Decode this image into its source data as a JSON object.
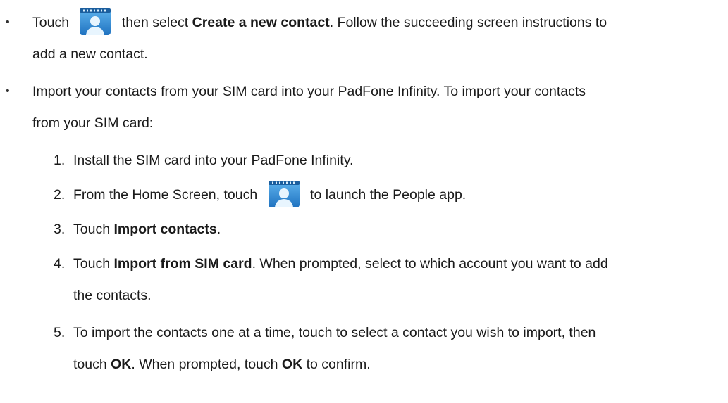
{
  "items": [
    {
      "bullet": "•",
      "line1_a": "Touch",
      "line1_b": "then select",
      "line1_bold": "Create a new contact",
      "line1_c": ". Follow the succeeding screen instructions to",
      "line2": "add a new contact."
    },
    {
      "bullet": "•",
      "line1": "Import your contacts from your SIM card into your PadFone Infinity. To import your contacts",
      "line2": "from your SIM card:"
    }
  ],
  "steps": [
    {
      "num": "1.",
      "text": "Install the SIM card into your PadFone Infinity."
    },
    {
      "num": "2.",
      "text_a": "From the Home Screen, touch",
      "text_b": "to launch the People app."
    },
    {
      "num": "3.",
      "text_a": "Touch",
      "bold": "Import contacts",
      "text_b": "."
    },
    {
      "num": "4.",
      "text_a": "Touch",
      "bold": "Import from SIM card",
      "text_b": ". When prompted, select to which account you want to add",
      "line2": "the contacts."
    },
    {
      "num": "5.",
      "line1": "To import the contacts one at a time, touch to select a contact you wish to import, then",
      "line2_a": "touch",
      "line2_bold1": "OK",
      "line2_b": ". When prompted, touch",
      "line2_bold2": "OK",
      "line2_c": "to confirm."
    }
  ],
  "icons": {
    "people_app": "people-app-icon"
  },
  "colors": {
    "icon_blue": "#2f8fd6",
    "icon_dark": "#1b5e9e",
    "text": "#1a1a1a"
  }
}
